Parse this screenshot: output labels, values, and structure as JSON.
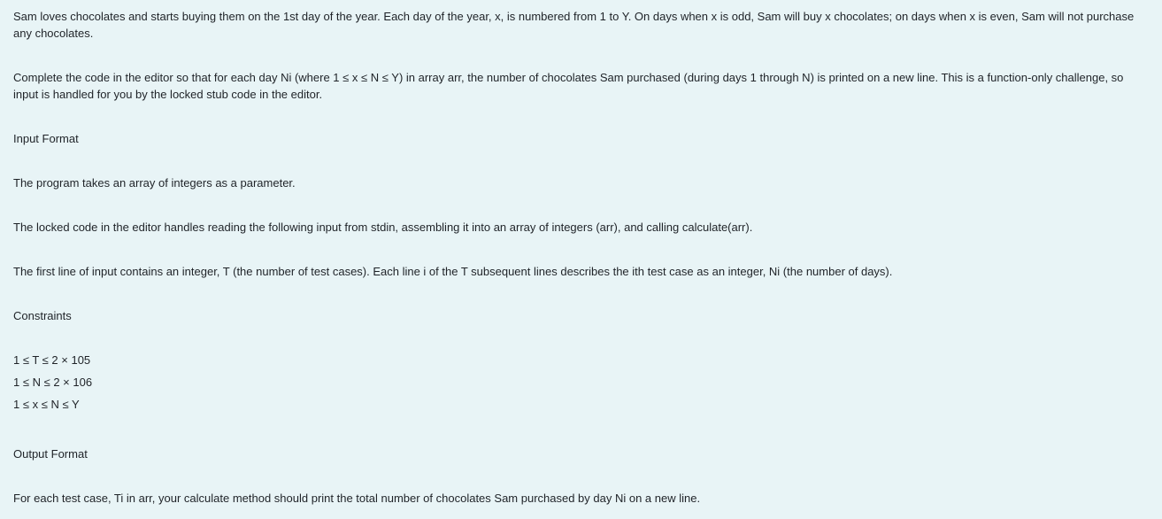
{
  "problem": {
    "intro": "Sam loves chocolates and starts buying them on the 1st day of the year. Each day of the year, x, is numbered from 1 to Y. On days when x is odd, Sam will buy x chocolates; on days when x is even, Sam will not purchase any chocolates.",
    "task": "Complete the code in the editor so that for each day Ni (where 1 ≤ x ≤ N ≤ Y) in array arr, the number of chocolates Sam purchased (during days 1 through N) is printed on a new line. This is a function-only challenge, so input is handled for you by the locked stub code in the editor.",
    "input_heading": "Input Format",
    "input_paragraphs": [
      "The program takes an array of integers as a parameter.",
      "The locked code in the editor handles reading the following input from stdin, assembling it into an array of integers (arr), and calling calculate(arr).",
      "The first line of input contains an integer, T (the number of test cases). Each line i of the T subsequent lines describes the ith test case as an integer, Ni (the number of days)."
    ],
    "constraints_heading": "Constraints",
    "constraints": [
      "1 ≤ T ≤ 2 × 105",
      "1 ≤ N ≤ 2 × 106",
      "1 ≤ x ≤ N ≤ Y"
    ],
    "output_heading": "Output Format",
    "output_text": "For each test case, Ti in arr, your calculate method should print the total number of chocolates Sam purchased by day Ni on a new line."
  }
}
